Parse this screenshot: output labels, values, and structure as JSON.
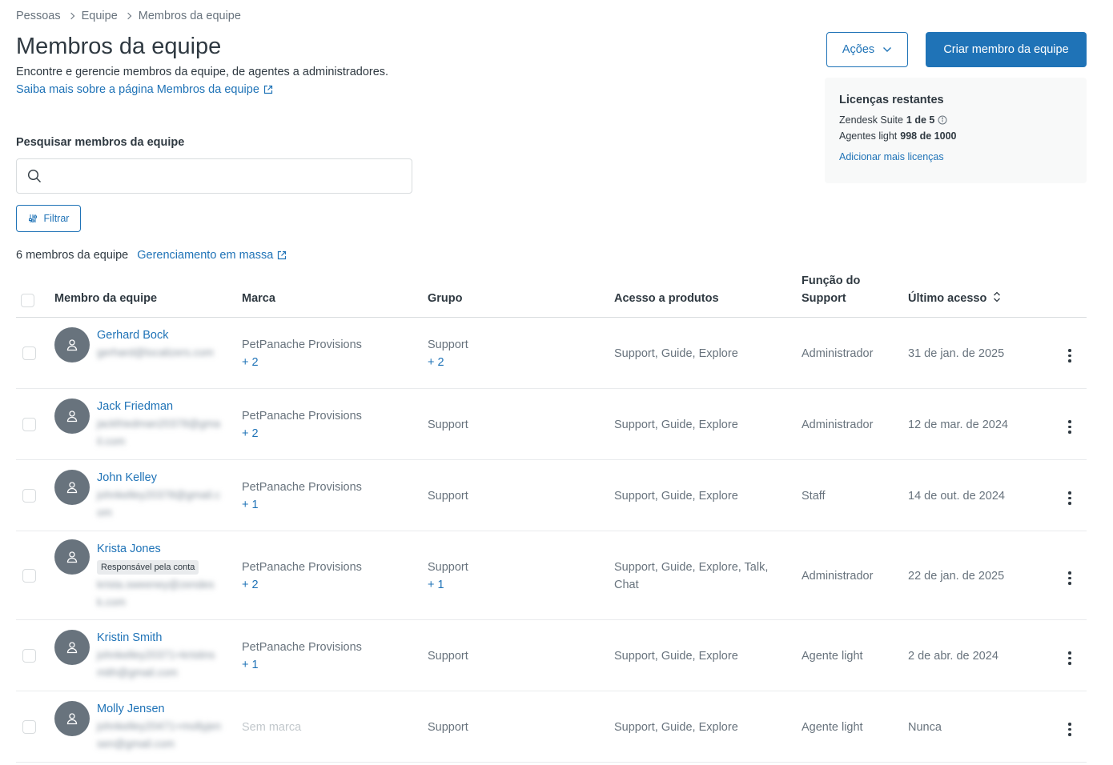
{
  "breadcrumb": [
    "Pessoas",
    "Equipe",
    "Membros da equipe"
  ],
  "page": {
    "title": "Membros da equipe",
    "description": "Encontre e gerencie membros da equipe, de agentes a administradores.",
    "learn_more": "Saiba mais sobre a página Membros da equipe"
  },
  "actions": {
    "actions_label": "Ações",
    "create_label": "Criar membro da equipe"
  },
  "licenses": {
    "title": "Licenças restantes",
    "suite_label": "Zendesk Suite",
    "suite_value": "1 de 5",
    "light_label": "Agentes light",
    "light_value": "998 de 1000",
    "add_link": "Adicionar mais licenças"
  },
  "search": {
    "label": "Pesquisar membros da equipe",
    "value": "",
    "placeholder": ""
  },
  "filter": {
    "label": "Filtrar"
  },
  "summary": {
    "count": "6 membros da equipe",
    "bulk_link": "Gerenciamento em massa"
  },
  "table": {
    "headers": {
      "member": "Membro da equipe",
      "brand": "Marca",
      "group": "Grupo",
      "products": "Acesso a produtos",
      "role_line1": "Função do",
      "role_line2": "Support",
      "last_access": "Último acesso"
    },
    "rows": [
      {
        "name": "Gerhard Bock",
        "email": "gerhard@localizers.com",
        "badge": "",
        "brand": "PetPanache Provisions",
        "brand_more": "+ 2",
        "group": "Support",
        "group_more": "+ 2",
        "products": "Support, Guide, Explore",
        "role": "Administrador",
        "last_access": "31 de jan. de 2025"
      },
      {
        "name": "Jack Friedman",
        "email": "jackfriedman20378@gmail.com",
        "badge": "",
        "brand": "PetPanache Provisions",
        "brand_more": "+ 2",
        "group": "Support",
        "group_more": "",
        "products": "Support, Guide, Explore",
        "role": "Administrador",
        "last_access": "12 de mar. de 2024"
      },
      {
        "name": "John Kelley",
        "email": "johnkelley20378@gmail.com",
        "badge": "",
        "brand": "PetPanache Provisions",
        "brand_more": "+ 1",
        "group": "Support",
        "group_more": "",
        "products": "Support, Guide, Explore",
        "role": "Staff",
        "last_access": "14 de out. de 2024"
      },
      {
        "name": "Krista Jones",
        "email": "krista.sweeney@zendesk.com",
        "badge": "Responsável pela conta",
        "brand": "PetPanache Provisions",
        "brand_more": "+ 2",
        "group": "Support",
        "group_more": "+ 1",
        "products": "Support, Guide, Explore, Talk, Chat",
        "role": "Administrador",
        "last_access": "22 de jan. de 2025"
      },
      {
        "name": "Kristin Smith",
        "email": "johnkelley20371+kristinsmith@gmail.com",
        "badge": "",
        "brand": "PetPanache Provisions",
        "brand_more": "+ 1",
        "group": "Support",
        "group_more": "",
        "products": "Support, Guide, Explore",
        "role": "Agente light",
        "last_access": "2 de abr. de 2024"
      },
      {
        "name": "Molly Jensen",
        "email": "johnkelley20471+mollyjensen@gmail.com",
        "badge": "",
        "brand": "Sem marca",
        "brand_more": "",
        "group": "Support",
        "group_more": "",
        "products": "Support, Guide, Explore",
        "role": "Agente light",
        "last_access": "Nunca"
      }
    ]
  },
  "colors": {
    "accent": "#1f73b7",
    "text": "#2f3941",
    "muted": "#68737d",
    "border": "#d8dcde",
    "panel": "#f8f9f9"
  }
}
